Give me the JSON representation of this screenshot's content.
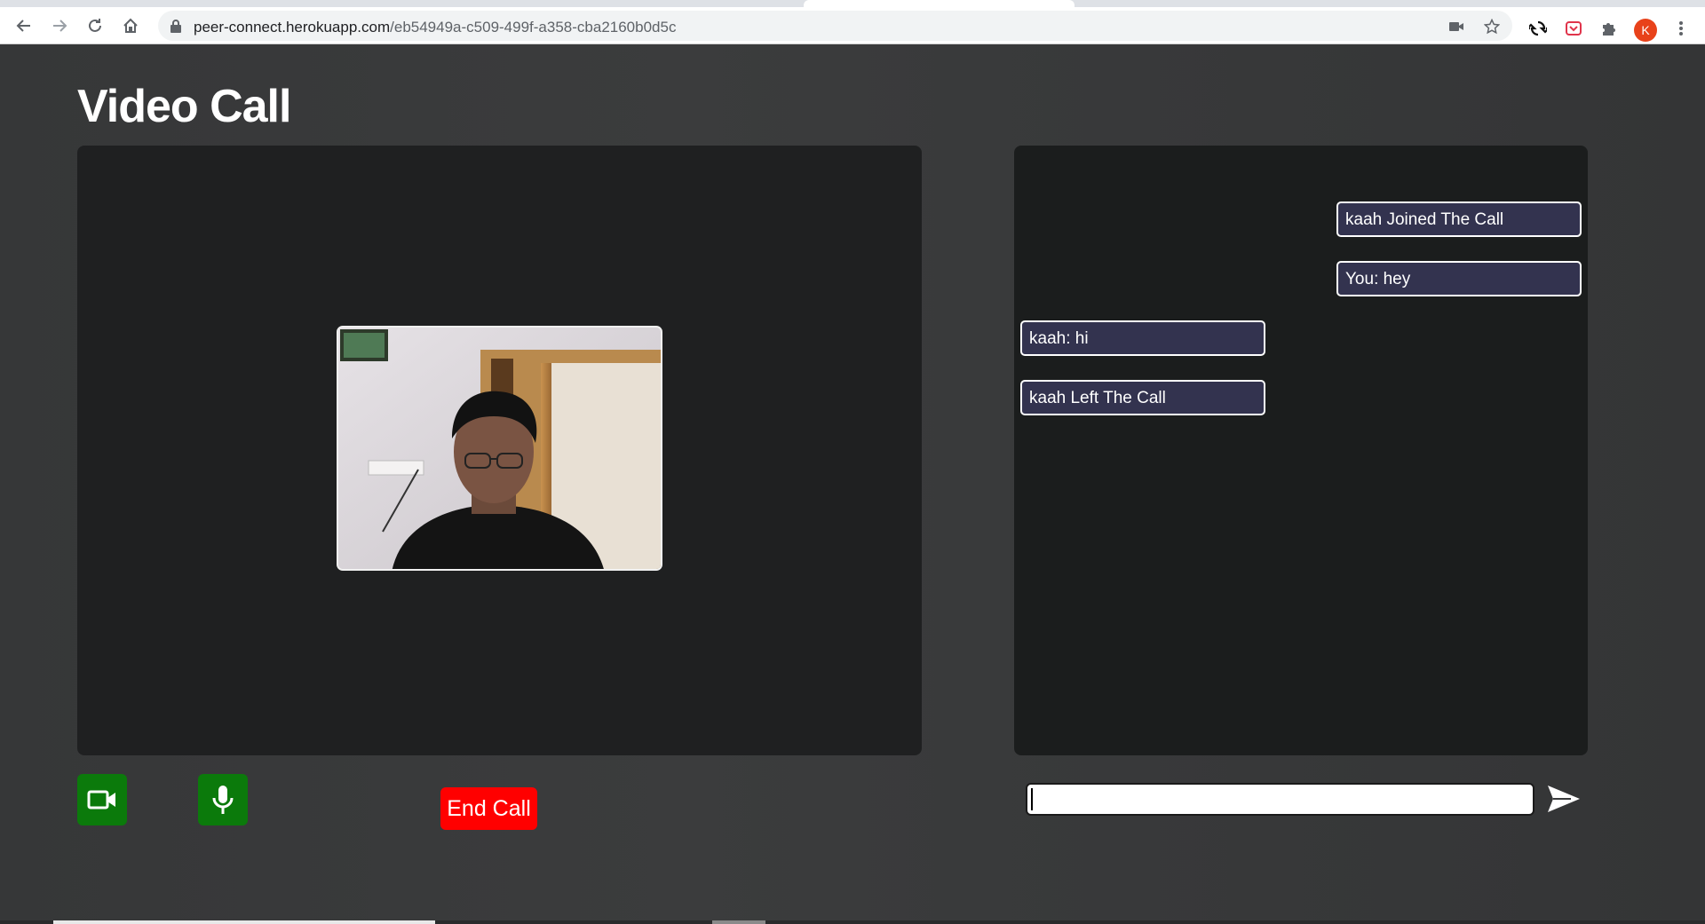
{
  "browser": {
    "url_host": "peer-connect.herokuapp.com",
    "url_path": "/eb54949a-c509-499f-a358-cba2160b0d5c",
    "profile_initial": "K"
  },
  "page": {
    "title": "Video Call"
  },
  "controls": {
    "end_call_label": "End Call"
  },
  "chat": {
    "messages": [
      {
        "text": "kaah Joined The Call",
        "side": "right"
      },
      {
        "text": "You: hey",
        "side": "right"
      },
      {
        "text": "kaah: hi",
        "side": "left"
      },
      {
        "text": "kaah Left The Call",
        "side": "left"
      }
    ],
    "input_value": ""
  },
  "colors": {
    "background": "#3a3b3c",
    "panel": "#1f2021",
    "message_bg": "#33334f",
    "control_green": "#0b7a0b",
    "end_call_red": "#ff0000"
  }
}
